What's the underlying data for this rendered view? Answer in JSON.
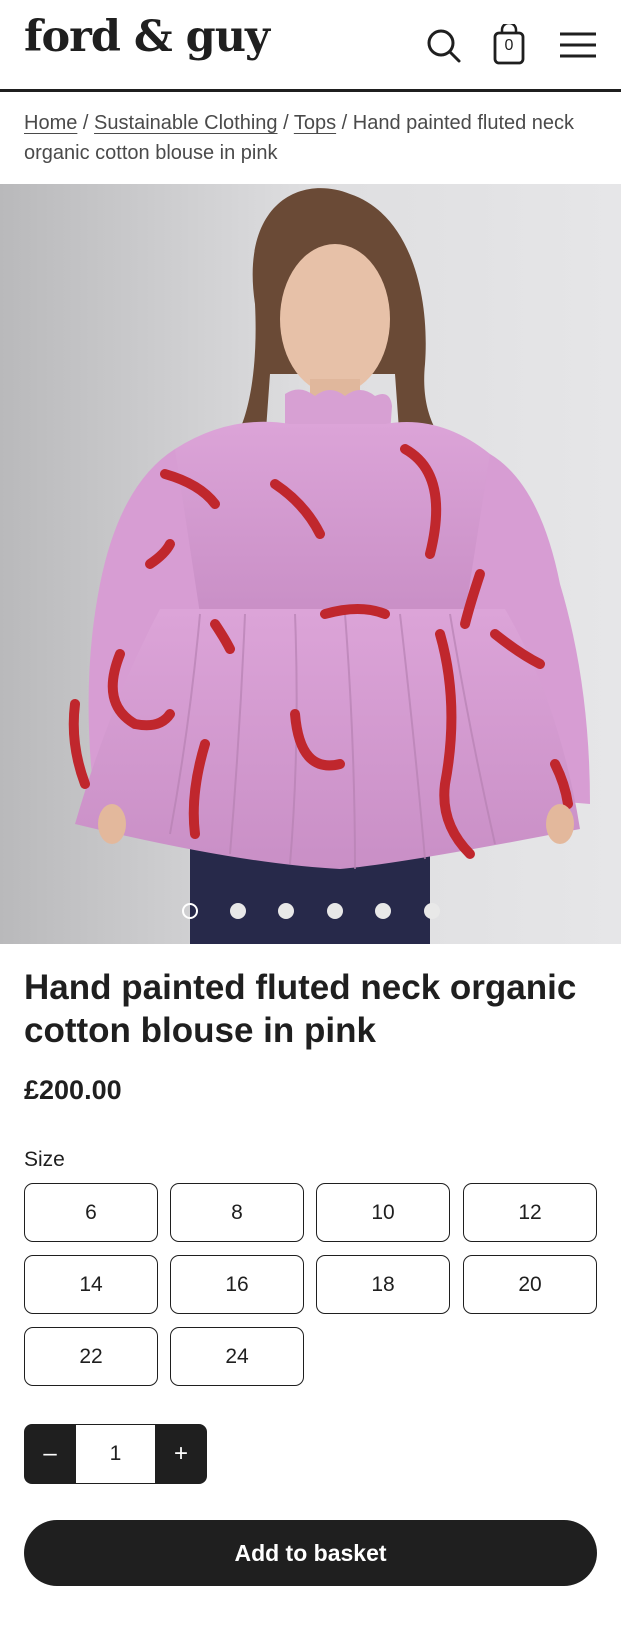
{
  "header": {
    "logo": "ford & guy",
    "basket_count": "0",
    "icons": [
      "search-icon",
      "basket-icon",
      "menu-icon"
    ]
  },
  "breadcrumb": {
    "items": [
      {
        "label": "Home"
      },
      {
        "label": "Sustainable Clothing"
      },
      {
        "label": "Tops"
      }
    ],
    "current": "Hand painted fluted neck organic cotton blouse in pink",
    "separator": "/"
  },
  "gallery": {
    "slide_count": 6,
    "active_index": 0
  },
  "product": {
    "title": "Hand painted fluted neck organic cotton blouse in pink",
    "price": "£200.00"
  },
  "size": {
    "label": "Size",
    "options": [
      "6",
      "8",
      "10",
      "12",
      "14",
      "16",
      "18",
      "20",
      "22",
      "24"
    ]
  },
  "quantity": {
    "minus": "–",
    "value": "1",
    "plus": "+"
  },
  "actions": {
    "add_to_basket": "Add to basket"
  },
  "colors": {
    "text": "#1f1f1f",
    "blouse_pink": "#d99bd6",
    "pattern_red": "#c0272d",
    "background": "#ffffff"
  }
}
